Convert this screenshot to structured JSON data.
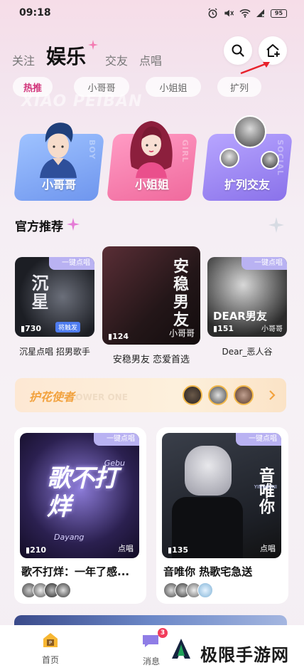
{
  "status": {
    "time": "09:18",
    "battery": "95"
  },
  "nav": {
    "tabs": [
      "关注",
      "娱乐",
      "交友",
      "点唱"
    ],
    "active_index": 1
  },
  "chips": [
    "热推",
    "小哥哥",
    "小姐姐",
    "扩列"
  ],
  "watermark_bg": "XIAO PEIBAN",
  "categories": [
    {
      "label": "小哥哥",
      "vert": "BOY",
      "color": "#7da6f2"
    },
    {
      "label": "小姐姐",
      "vert": "GIRL",
      "color": "#f47aa8"
    },
    {
      "label": "扩列交友",
      "vert": "SOCIAL",
      "color": "#9d86ef"
    }
  ],
  "section": {
    "title": "官方推荐"
  },
  "recommend": [
    {
      "count": "730",
      "caption": "沉星点唱 招男歌手",
      "cover_text": "沉星",
      "badge": "一键点唱",
      "sub": "将触发"
    },
    {
      "count": "124",
      "caption": "安稳男友 恋爱首选",
      "cover_text": "安稳男友",
      "badge": "",
      "sub": "小哥哥"
    },
    {
      "count": "151",
      "caption": "Dear_恶人谷",
      "cover_text": "DEAR男友",
      "badge": "一键点唱",
      "sub": "小哥哥"
    }
  ],
  "banner": {
    "title": "护花使者",
    "bg_text": "FLOWER ONE"
  },
  "rooms": [
    {
      "title": "歌不打烊：一年了感...",
      "count": "210",
      "badge": "一键点唱",
      "tag": "点唱",
      "cover_text": "歌不打烊",
      "en1": "Gebu",
      "en2": "Dayang"
    },
    {
      "title": "音唯你 热歌宅急送",
      "count": "135",
      "badge": "一键点唱",
      "tag": "点唱",
      "cover_text": "音唯你",
      "en1": "YINWEINI",
      "en2": ""
    }
  ],
  "tabbar": {
    "home": "首页",
    "messages": "消息",
    "messages_badge": "3"
  },
  "watermark": "极限手游网"
}
